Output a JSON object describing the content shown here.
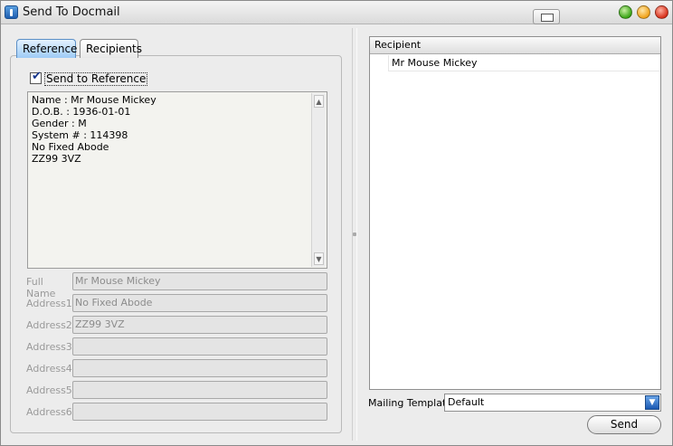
{
  "window": {
    "title": "Send To Docmail",
    "controls": {
      "maximize": "green",
      "minimize": "yellow",
      "close": "red"
    }
  },
  "tabs": [
    {
      "label": "Reference",
      "active": true
    },
    {
      "label": "Recipients",
      "active": false
    }
  ],
  "reference": {
    "send_label": "Send to Reference",
    "checked": true,
    "lines": [
      "Name : Mr Mouse Mickey",
      "D.O.B. : 1936-01-01",
      "Gender : M",
      "System # : 114398",
      "No Fixed Abode",
      "ZZ99 3VZ"
    ]
  },
  "fields": [
    {
      "label": "Full Name",
      "value": "Mr Mouse Mickey"
    },
    {
      "label": "Address1",
      "value": "No Fixed Abode"
    },
    {
      "label": "Address2",
      "value": "ZZ99 3VZ"
    },
    {
      "label": "Address3",
      "value": ""
    },
    {
      "label": "Address4",
      "value": ""
    },
    {
      "label": "Address5",
      "value": ""
    },
    {
      "label": "Address6",
      "value": ""
    }
  ],
  "recipients_table": {
    "header": "Recipient",
    "rows": [
      "Mr Mouse Mickey"
    ]
  },
  "mailing": {
    "label": "Mailing Template",
    "selected": "Default"
  },
  "send_button": "Send",
  "colors": {
    "accent": "#1a59b3",
    "tab_active": "#9ecbf6",
    "window_bg": "#ececec"
  }
}
